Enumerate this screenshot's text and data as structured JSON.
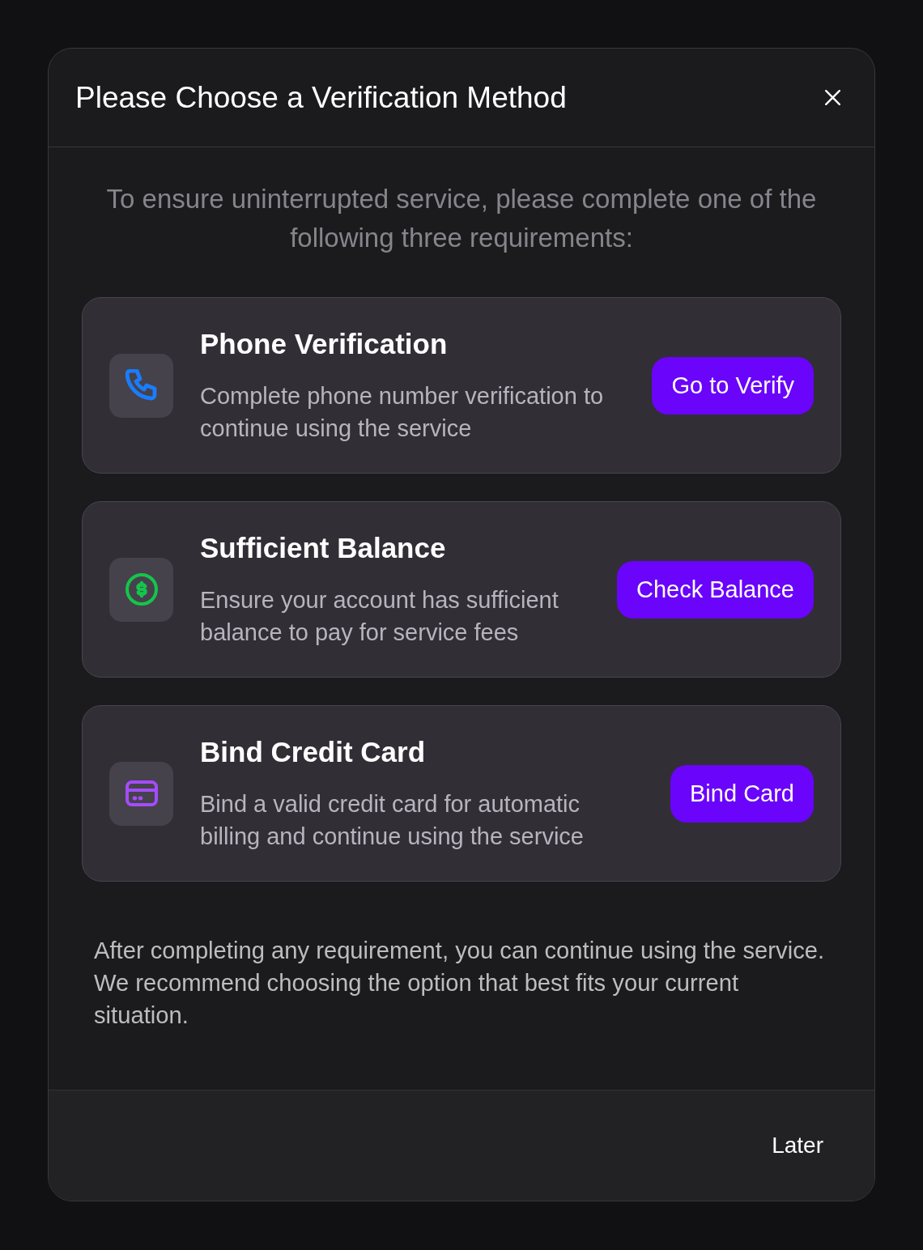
{
  "dialog": {
    "title": "Please Choose a Verification Method",
    "intro": "To ensure uninterrupted service, please complete one of the following three requirements:",
    "methods": [
      {
        "kind": "phone",
        "color": "#1a7cff",
        "title": "Phone Verification",
        "description": "Complete phone number verification to continue using the service",
        "button": "Go to Verify"
      },
      {
        "kind": "balance",
        "color": "#16c44c",
        "title": "Sufficient Balance",
        "description": "Ensure your account has sufficient balance to pay for service fees",
        "button": "Check Balance"
      },
      {
        "kind": "card",
        "color": "#a64bff",
        "title": "Bind Credit Card",
        "description": "Bind a valid credit card for automatic billing and continue using the service",
        "button": "Bind Card"
      }
    ],
    "note": "After completing any requirement, you can continue using the service. We recommend choosing the option that best fits your current situation.",
    "footer_buttons": [
      "Later"
    ]
  }
}
